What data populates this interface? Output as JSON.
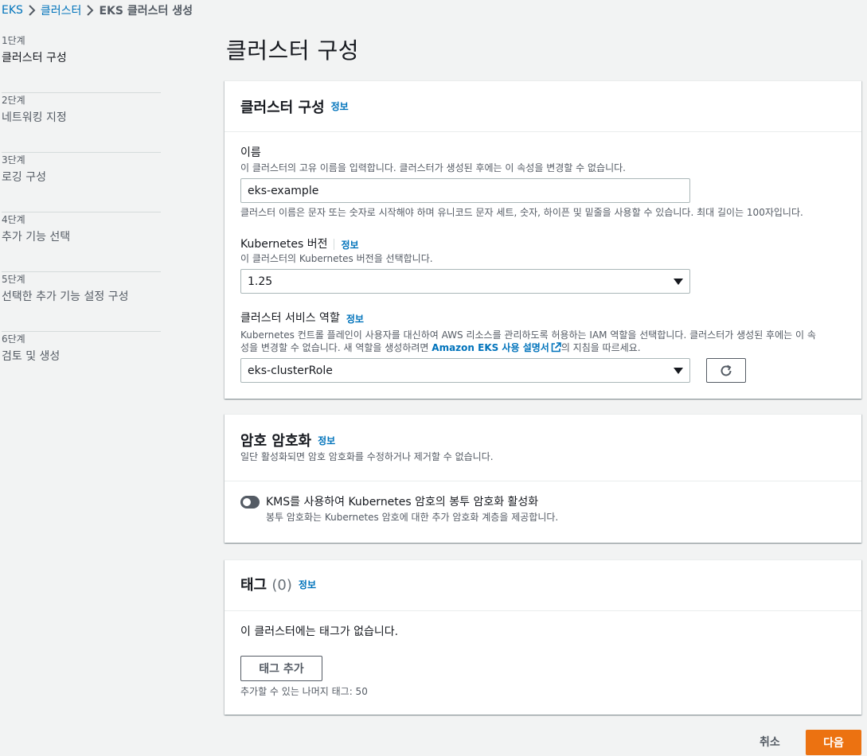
{
  "breadcrumb": {
    "items": [
      "EKS",
      "클러스터",
      "EKS 클러스터 생성"
    ]
  },
  "steps": [
    {
      "num": "1단계",
      "title": "클러스터 구성"
    },
    {
      "num": "2단계",
      "title": "네트워킹 지정"
    },
    {
      "num": "3단계",
      "title": "로깅 구성"
    },
    {
      "num": "4단계",
      "title": "추가 기능 선택"
    },
    {
      "num": "5단계",
      "title": "선택한 추가 기능 설정 구성"
    },
    {
      "num": "6단계",
      "title": "검토 및 생성"
    }
  ],
  "page_title": "클러스터 구성",
  "cluster_config": {
    "header": "클러스터 구성",
    "info": "정보",
    "name": {
      "label": "이름",
      "description": "이 클러스터의 고유 이름을 입력합니다. 클러스터가 생성된 후에는 이 속성을 변경할 수 없습니다.",
      "value": "eks-example",
      "constraint": "클러스터 이름은 문자 또는 숫자로 시작해야 하며 유니코드 문자 세트, 숫자, 하이픈 및 밑줄을 사용할 수 있습니다. 최대 길이는 100자입니다."
    },
    "version": {
      "label": "Kubernetes 버전",
      "info": "정보",
      "description": "이 클러스터의 Kubernetes 버전을 선택합니다.",
      "value": "1.25"
    },
    "role": {
      "label": "클러스터 서비스 역할",
      "info": "정보",
      "description_line1": "Kubernetes 컨트롤 플레인이 사용자를 대신하여 AWS 리소스를 관리하도록 허용하는 IAM 역할을 선택합니다. 클러스터가 생성된 후에는 이 속",
      "description_line2_prefix": "성을 변경할 수 없습니다. 새 역할을 생성하려면 ",
      "guide_link": "Amazon EKS 사용 설명서",
      "description_line2_suffix": "의 지침을 따르세요.",
      "value": "eks-clusterRole"
    }
  },
  "encryption": {
    "header": "암호 암호화",
    "info": "정보",
    "description": "일단 활성화되면 암호 암호화를 수정하거나 제거할 수 없습니다.",
    "toggle_label": "KMS를 사용하여 Kubernetes 암호의 봉투 암호화 활성화",
    "toggle_desc": "봉투 암호화는 Kubernetes 암호에 대한 추가 암호화 계층을 제공합니다.",
    "enabled": false
  },
  "tags": {
    "header": "태그",
    "count": "(0)",
    "info": "정보",
    "empty_text": "이 클러스터에는 태그가 없습니다.",
    "add_button": "태그 추가",
    "remaining": "추가할 수 있는 나머지 태그: 50"
  },
  "footer": {
    "cancel": "취소",
    "next": "다음"
  },
  "colors": {
    "link": "#0073bb",
    "primary_button": "#ec7211",
    "background": "#f2f3f3"
  }
}
